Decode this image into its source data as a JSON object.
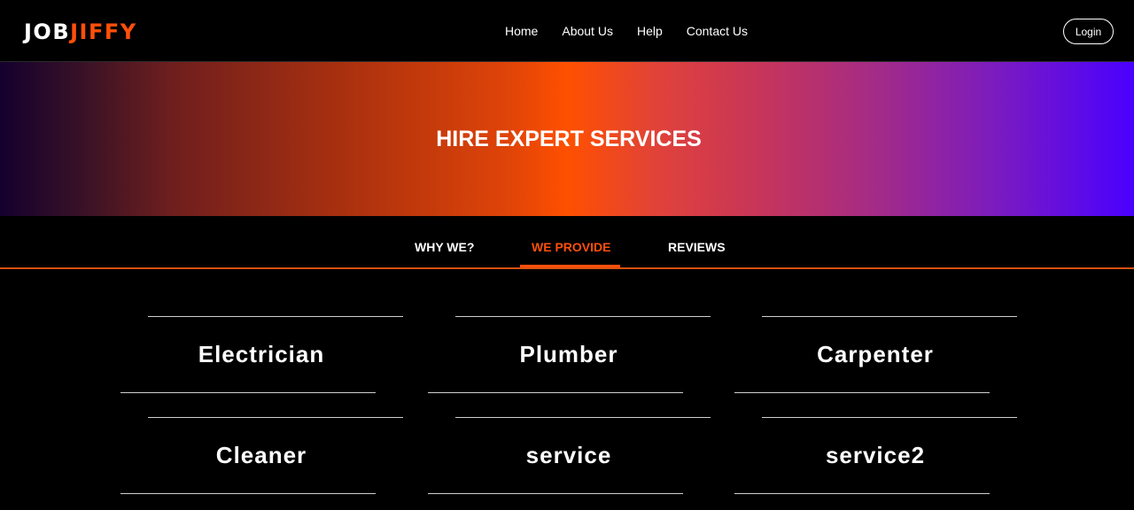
{
  "brand": {
    "part1": "JOB",
    "part2": "JIFFY",
    "accent_color": "#ff4f0a"
  },
  "nav": {
    "items": [
      {
        "label": "Home"
      },
      {
        "label": "About Us"
      },
      {
        "label": "Help"
      },
      {
        "label": "Contact Us"
      }
    ],
    "login_label": "Login"
  },
  "hero": {
    "title": "HIRE EXPERT SERVICES"
  },
  "tabs": [
    {
      "label": "WHY WE?",
      "active": false
    },
    {
      "label": "WE PROVIDE",
      "active": true
    },
    {
      "label": "REVIEWS",
      "active": false
    }
  ],
  "services": [
    {
      "label": "Electrician"
    },
    {
      "label": "Plumber"
    },
    {
      "label": "Carpenter"
    },
    {
      "label": "Cleaner"
    },
    {
      "label": "service"
    },
    {
      "label": "service2"
    }
  ]
}
